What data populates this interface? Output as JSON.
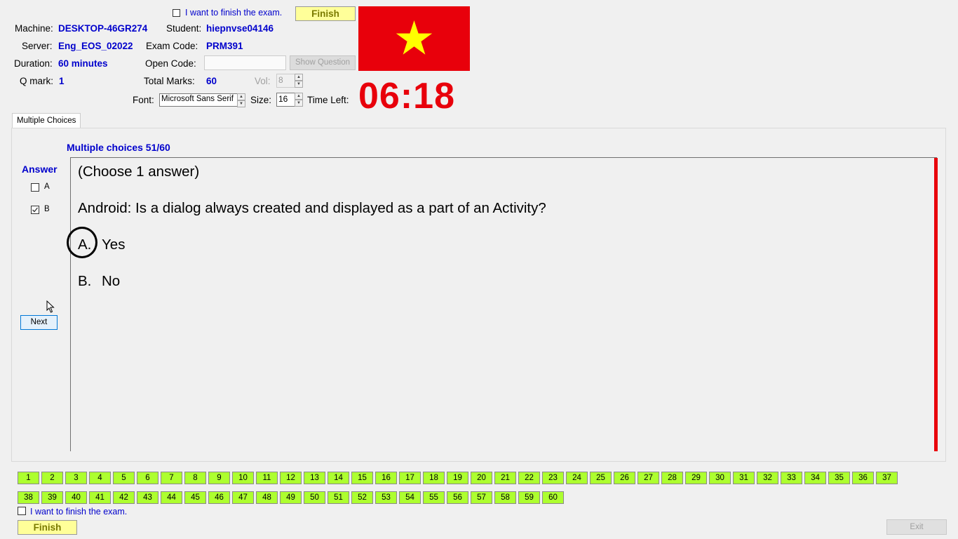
{
  "header": {
    "finish_checkbox_label": "I want to finish the exam.",
    "finish_button": "Finish",
    "machine_label": "Machine:",
    "machine_value": "DESKTOP-46GR274",
    "student_label": "Student:",
    "student_value": "hiepnvse04146",
    "server_label": "Server:",
    "server_value": "Eng_EOS_02022",
    "exam_code_label": "Exam Code:",
    "exam_code_value": "PRM391",
    "duration_label": "Duration:",
    "duration_value": "60 minutes",
    "open_code_label": "Open Code:",
    "open_code_value": "",
    "show_question_button": "Show Question",
    "qmark_label": "Q mark:",
    "qmark_value": "1",
    "total_marks_label": "Total Marks:",
    "total_marks_value": "60",
    "vol_label": "Vol:",
    "vol_value": "8",
    "font_label": "Font:",
    "font_value": "Microsoft Sans Serif",
    "size_label": "Size:",
    "size_value": "16",
    "time_left_label": "Time Left:",
    "timer": "06:18",
    "flag_colors": {
      "field": "#e8000b",
      "star": "#ffff00"
    }
  },
  "tabs": [
    "Multiple Choices"
  ],
  "question": {
    "heading": "Multiple choices 51/60",
    "instruction": "(Choose 1 answer)",
    "text": "Android: Is a dialog always created and displayed as a part of an Activity?",
    "options": [
      {
        "letter": "A.",
        "text": "Yes"
      },
      {
        "letter": "B.",
        "text": "No"
      }
    ]
  },
  "answer": {
    "title": "Answer",
    "choices": [
      {
        "label": "A",
        "checked": false
      },
      {
        "label": "B",
        "checked": true
      }
    ],
    "next_button": "Next"
  },
  "navigation": {
    "row1": [
      "1",
      "2",
      "3",
      "4",
      "5",
      "6",
      "7",
      "8",
      "9",
      "10",
      "11",
      "12",
      "13",
      "14",
      "15",
      "16",
      "17",
      "18",
      "19",
      "20",
      "21",
      "22",
      "23",
      "24",
      "25",
      "26",
      "27",
      "28",
      "29",
      "30",
      "31",
      "32",
      "33",
      "34",
      "35",
      "36",
      "37"
    ],
    "row2": [
      "38",
      "39",
      "40",
      "41",
      "42",
      "43",
      "44",
      "45",
      "46",
      "47",
      "48",
      "49",
      "50",
      "51",
      "52",
      "53",
      "54",
      "55",
      "56",
      "57",
      "58",
      "59",
      "60"
    ]
  },
  "footer": {
    "finish_checkbox_label": "I want to finish the exam.",
    "finish_button": "Finish",
    "exit_button": "Exit"
  },
  "accent_colors": {
    "blue_text": "#0000cc",
    "red": "#e8000b",
    "nav_green": "#adff2f",
    "finish_yellow": "#ffff99"
  }
}
